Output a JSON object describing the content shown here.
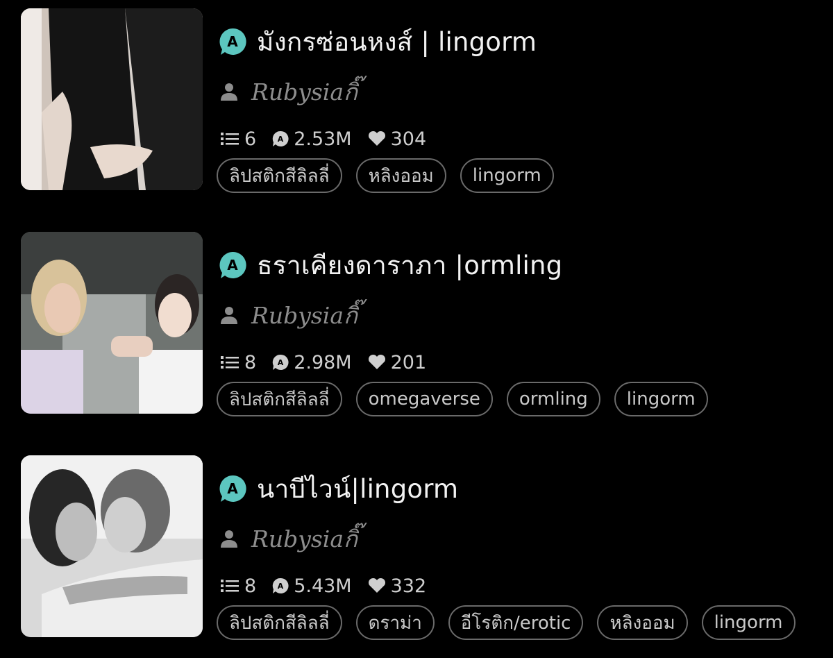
{
  "stories": [
    {
      "title": "มังกรซ่อนหงส์ | lingorm",
      "author": "Rubysiaกิ๊",
      "parts": "6",
      "reads": "2.53M",
      "votes": "304",
      "tags": [
        "ลิปสติกสีลิลลี่",
        "หลิงออม",
        "lingorm"
      ]
    },
    {
      "title": "ธราเคียงดาราภา |ormling",
      "author": "Rubysiaกิ๊",
      "parts": "8",
      "reads": "2.98M",
      "votes": "201",
      "tags": [
        "ลิปสติกสีลิลลี่",
        "omegaverse",
        "ormling",
        "lingorm"
      ]
    },
    {
      "title": "นาบีไวน์|lingorm",
      "author": "Rubysiaกิ๊",
      "parts": "8",
      "reads": "5.43M",
      "votes": "332",
      "tags": [
        "ลิปสติกสีลิลลี่",
        "ดราม่า",
        "อีโรติก/erotic",
        "หลิงออม",
        "lingorm"
      ]
    }
  ],
  "colors": {
    "accent": "#5cc6bf",
    "tag_border": "#6a6a6a",
    "muted": "#8d8d8d"
  }
}
